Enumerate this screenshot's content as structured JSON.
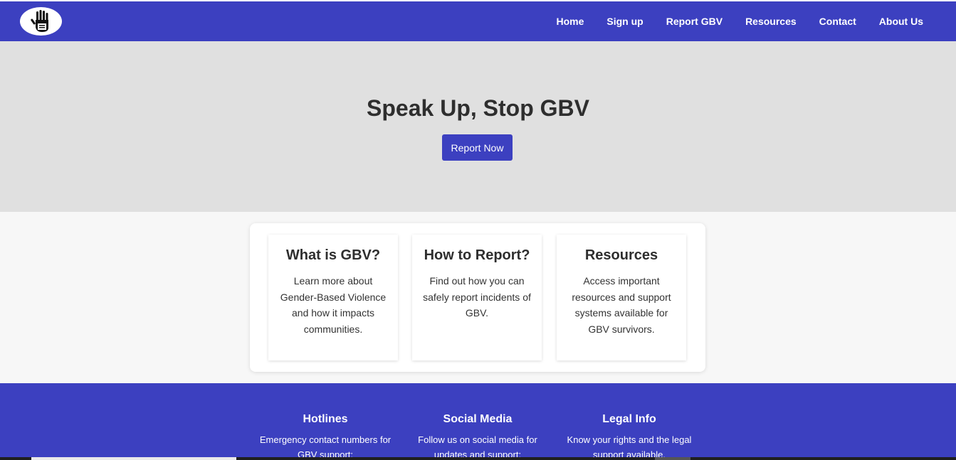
{
  "nav": {
    "logo_icon": "stop-gbv-hand-icon",
    "links": [
      "Home",
      "Sign up",
      "Report GBV",
      "Resources",
      "Contact",
      "About Us"
    ]
  },
  "hero": {
    "title": "Speak Up, Stop GBV",
    "button_label": "Report Now"
  },
  "features": [
    {
      "title": "What is GBV?",
      "text": "Learn more about Gender-Based Violence and how it impacts communities."
    },
    {
      "title": "How to Report?",
      "text": "Find out how you can safely report incidents of GBV."
    },
    {
      "title": "Resources",
      "text": "Access important resources and support systems available for GBV survivors."
    }
  ],
  "footer": [
    {
      "title": "Hotlines",
      "text": "Emergency contact numbers for GBV support:"
    },
    {
      "title": "Social Media",
      "text": "Follow us on social media for updates and support:"
    },
    {
      "title": "Legal Info",
      "text": "Know your rights and the legal support available."
    }
  ],
  "colors": {
    "brand": "#3c40c0",
    "hero_bg": "#e0e0e0",
    "page_bg": "#f7f7f7",
    "heading_text": "#2e2e2e"
  }
}
